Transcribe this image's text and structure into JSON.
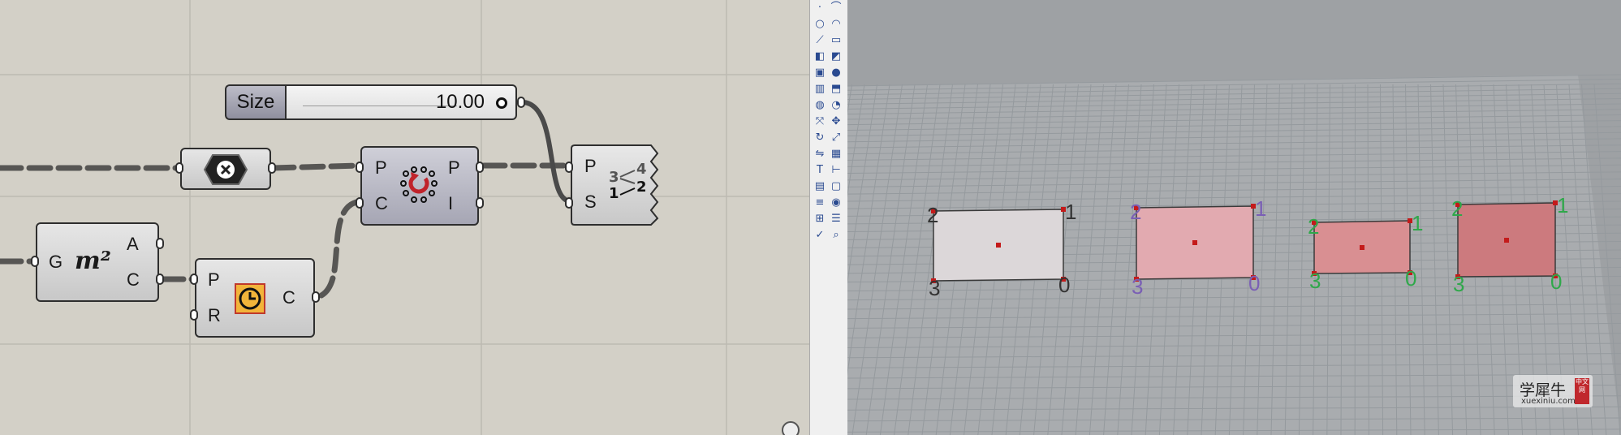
{
  "slider": {
    "name": "Size",
    "value": "10.00"
  },
  "nodes": {
    "negate": {
      "icon": "negate-x-icon"
    },
    "area": {
      "inputs": [
        "G"
      ],
      "outputs": [
        "A",
        "C"
      ],
      "icon_text": "m²"
    },
    "rectangle": {
      "inputs": [
        "P",
        "R"
      ],
      "outputs": [
        "C"
      ],
      "icon": "rectangle-clock-icon"
    },
    "polar_array": {
      "inputs": [
        "P",
        "C"
      ],
      "outputs": [
        "P",
        "I"
      ],
      "icon": "rotate-array-icon"
    },
    "sort_points": {
      "inputs": [
        "P",
        "S"
      ],
      "icon_text": [
        "3",
        "4",
        "1",
        "2"
      ]
    }
  },
  "toolbar": {
    "icons": [
      "point-icon",
      "curve-icon",
      "circle-icon",
      "arc-icon",
      "polyline-icon",
      "rectangle-icon",
      "surface-icon",
      "loft-icon",
      "box-icon",
      "sphere-icon",
      "cylinder-icon",
      "extrude-icon",
      "boolean-icon",
      "fillet-icon",
      "transform-icon",
      "move-icon",
      "rotate-icon",
      "scale-icon",
      "mirror-icon",
      "array-icon",
      "text-icon",
      "dimension-icon",
      "group-icon",
      "block-icon",
      "layer-icon",
      "render-icon",
      "grid-icon",
      "properties-icon",
      "check-icon",
      "analyze-icon"
    ]
  },
  "viewport": {
    "rectangles": [
      {
        "labels": [
          "0",
          "1",
          "2",
          "3"
        ],
        "label_color": "#333333",
        "fill": "#dcd7d9"
      },
      {
        "labels": [
          "0",
          "1",
          "2",
          "3"
        ],
        "label_color": "#7a5fb5",
        "fill": "#e2aab0"
      },
      {
        "labels": [
          "0",
          "1",
          "2",
          "3"
        ],
        "label_color": "#2fa84a",
        "fill": "#d98f92"
      },
      {
        "labels": [
          "0",
          "1",
          "2",
          "3"
        ],
        "label_color": "#2fa84a",
        "fill": "#cc7a7e"
      }
    ]
  },
  "watermark": {
    "chinese": "学犀牛",
    "latin": "xuexiniu.com",
    "seal": "中文网"
  }
}
